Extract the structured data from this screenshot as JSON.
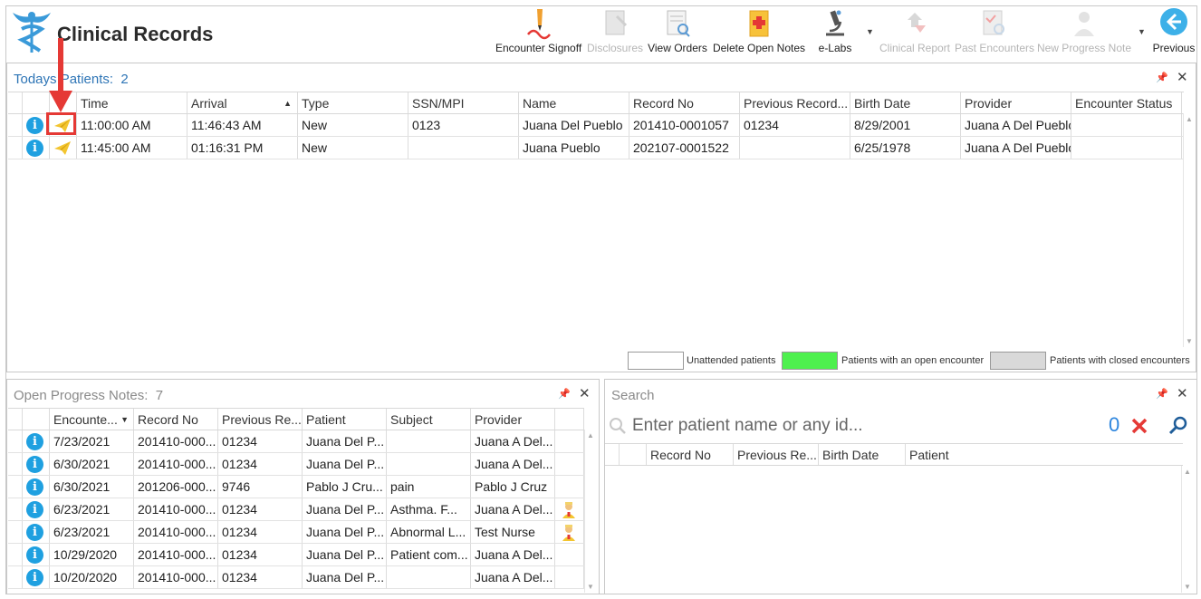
{
  "app": {
    "title": "Clinical Records"
  },
  "toolbar": [
    {
      "label": "Encounter Signoff",
      "icon": "signoff-icon",
      "disabled": false
    },
    {
      "label": "Disclosures",
      "icon": "disclosures-icon",
      "disabled": true
    },
    {
      "label": "View Orders",
      "icon": "view-orders-icon",
      "disabled": false
    },
    {
      "label": "Delete Open Notes",
      "icon": "delete-notes-icon",
      "disabled": false
    },
    {
      "label": "e-Labs",
      "icon": "microscope-icon",
      "disabled": false
    },
    {
      "label": "Clinical Report",
      "icon": "clinical-report-icon",
      "disabled": true
    },
    {
      "label": "Past Encounters",
      "icon": "past-encounters-icon",
      "disabled": true
    },
    {
      "label": "New Progress Note",
      "icon": "new-progress-note-icon",
      "disabled": true
    },
    {
      "label": "Previous",
      "icon": "back-arrow-icon",
      "disabled": false
    }
  ],
  "todays": {
    "title": "Todays Patients:",
    "count": "2",
    "columns": [
      "Time",
      "Arrival",
      "Type",
      "SSN/MPI",
      "Name",
      "Record No",
      "Previous Record...",
      "Birth Date",
      "Provider",
      "Encounter Status"
    ],
    "rows": [
      [
        "11:00:00 AM",
        "11:46:43 AM",
        "New",
        "0123",
        "Juana Del Pueblo",
        "201410-0001057",
        "01234",
        "8/29/2001",
        "Juana A Del Pueblo",
        ""
      ],
      [
        "11:45:00 AM",
        "01:16:31 PM",
        "New",
        "",
        "Juana Pueblo",
        "202107-0001522",
        "",
        "6/25/1978",
        "Juana A Del Pueblo",
        ""
      ]
    ],
    "legend": [
      "Unattended patients",
      "Patients with an open encounter",
      "Patients with closed encounters"
    ]
  },
  "notes": {
    "title": "Open Progress Notes:",
    "count": "7",
    "columns": [
      "Encounte...",
      "Record No",
      "Previous Re...",
      "Patient",
      "Subject",
      "Provider"
    ],
    "rows": [
      {
        "cells": [
          "7/23/2021",
          "201410-000...",
          "01234",
          "Juana Del P...",
          "",
          "Juana A Del..."
        ],
        "nurse": false
      },
      {
        "cells": [
          "6/30/2021",
          "201410-000...",
          "01234",
          "Juana Del P...",
          "",
          "Juana A Del..."
        ],
        "nurse": false
      },
      {
        "cells": [
          "6/30/2021",
          "201206-000...",
          "9746",
          "Pablo J Cru...",
          "pain",
          "Pablo J Cruz"
        ],
        "nurse": false
      },
      {
        "cells": [
          "6/23/2021",
          "201410-000...",
          "01234",
          "Juana Del P...",
          "Asthma.   F...",
          "Juana A Del..."
        ],
        "nurse": true
      },
      {
        "cells": [
          "6/23/2021",
          "201410-000...",
          "01234",
          "Juana Del P...",
          "Abnormal L...",
          "Test Nurse"
        ],
        "nurse": true
      },
      {
        "cells": [
          "10/29/2020",
          "201410-000...",
          "01234",
          "Juana Del P...",
          "Patient com...",
          "Juana A Del..."
        ],
        "nurse": false
      },
      {
        "cells": [
          "10/20/2020",
          "201410-000...",
          "01234",
          "Juana Del P...",
          "",
          "Juana A Del..."
        ],
        "nurse": false
      }
    ]
  },
  "search": {
    "title": "Search",
    "placeholder": "Enter patient name or any id...",
    "count": "0",
    "columns": [
      "Record No",
      "Previous Re...",
      "Birth Date",
      "Patient"
    ]
  },
  "colors": {
    "accent": "#2e75b6",
    "open": "#4ef04e",
    "closed": "#d9d9d9",
    "info": "#1fa0e0",
    "annotation": "#e53935"
  }
}
